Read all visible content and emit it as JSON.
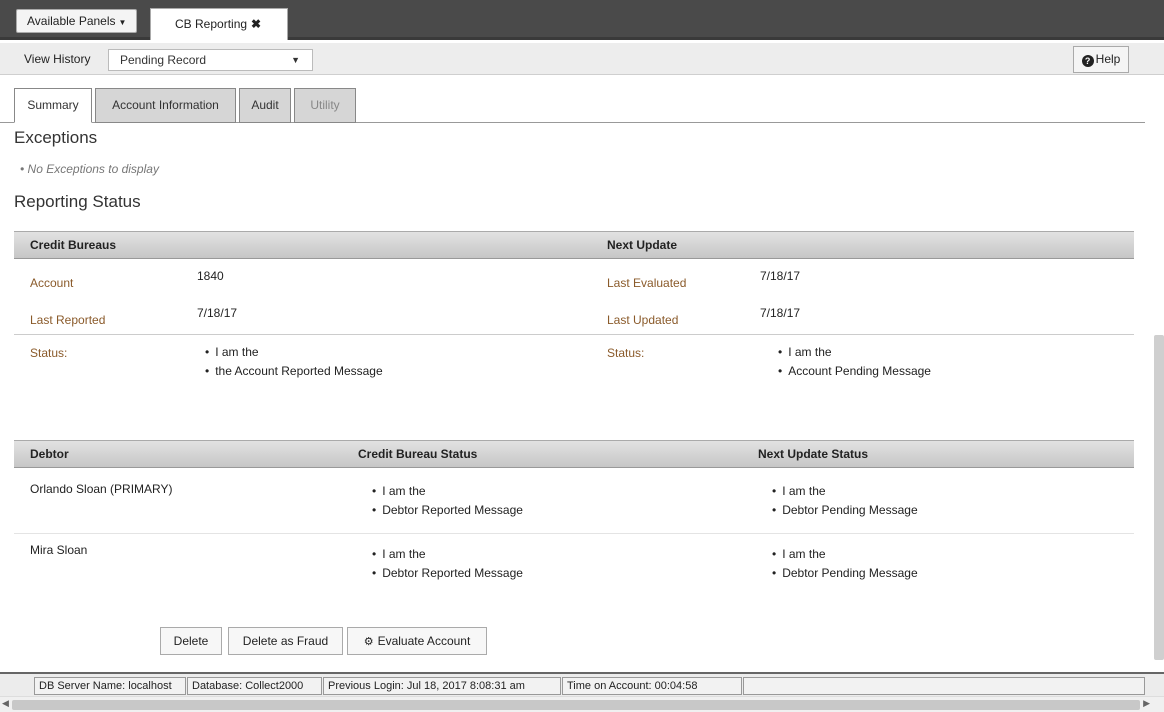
{
  "topbar": {
    "available_panels": "Available Panels",
    "panel_tab": "CB Reporting"
  },
  "history": {
    "label": "View History",
    "selected": "Pending Record",
    "help": "Help"
  },
  "tabs": [
    {
      "label": "Summary"
    },
    {
      "label": "Account Information"
    },
    {
      "label": "Audit"
    },
    {
      "label": "Utility"
    }
  ],
  "exceptions": {
    "title": "Exceptions",
    "empty": "No Exceptions to display"
  },
  "reporting": {
    "title": "Reporting Status",
    "credit_bureaus": "Credit Bureaus",
    "next_update": "Next Update",
    "account_label": "Account",
    "account_value": "1840",
    "last_reported_label": "Last Reported",
    "last_reported_value": "7/18/17",
    "last_evaluated_label": "Last Evaluated",
    "last_evaluated_value": "7/18/17",
    "last_updated_label": "Last Updated",
    "last_updated_value": "7/18/17",
    "status_label": "Status:",
    "cb_status": [
      "I am the",
      "the Account Reported Message"
    ],
    "nu_status": [
      "I am the",
      "Account Pending Message"
    ]
  },
  "debtors": {
    "headers": {
      "debtor": "Debtor",
      "cb_status": "Credit Bureau Status",
      "nu_status": "Next Update Status"
    },
    "rows": [
      {
        "name": "Orlando Sloan (PRIMARY)",
        "cb": [
          "I am the",
          "Debtor Reported Message"
        ],
        "nu": [
          "I am the",
          "Debtor Pending Message"
        ]
      },
      {
        "name": "Mira Sloan",
        "cb": [
          "I am the",
          "Debtor Reported Message"
        ],
        "nu": [
          "I am the",
          "Debtor Pending Message"
        ]
      }
    ]
  },
  "actions": {
    "delete": "Delete",
    "delete_fraud": "Delete as Fraud",
    "evaluate": "Evaluate Account"
  },
  "statusbar": {
    "server": "DB Server Name: localhost",
    "database": "Database: Collect2000",
    "login": "Previous Login: Jul 18, 2017 8:08:31 am",
    "time": "Time on Account: 00:04:58"
  },
  "colors": {
    "topbar": "#4a4a4a",
    "label": "#8a5a2a",
    "header_gradient": "#c6c6c6"
  }
}
